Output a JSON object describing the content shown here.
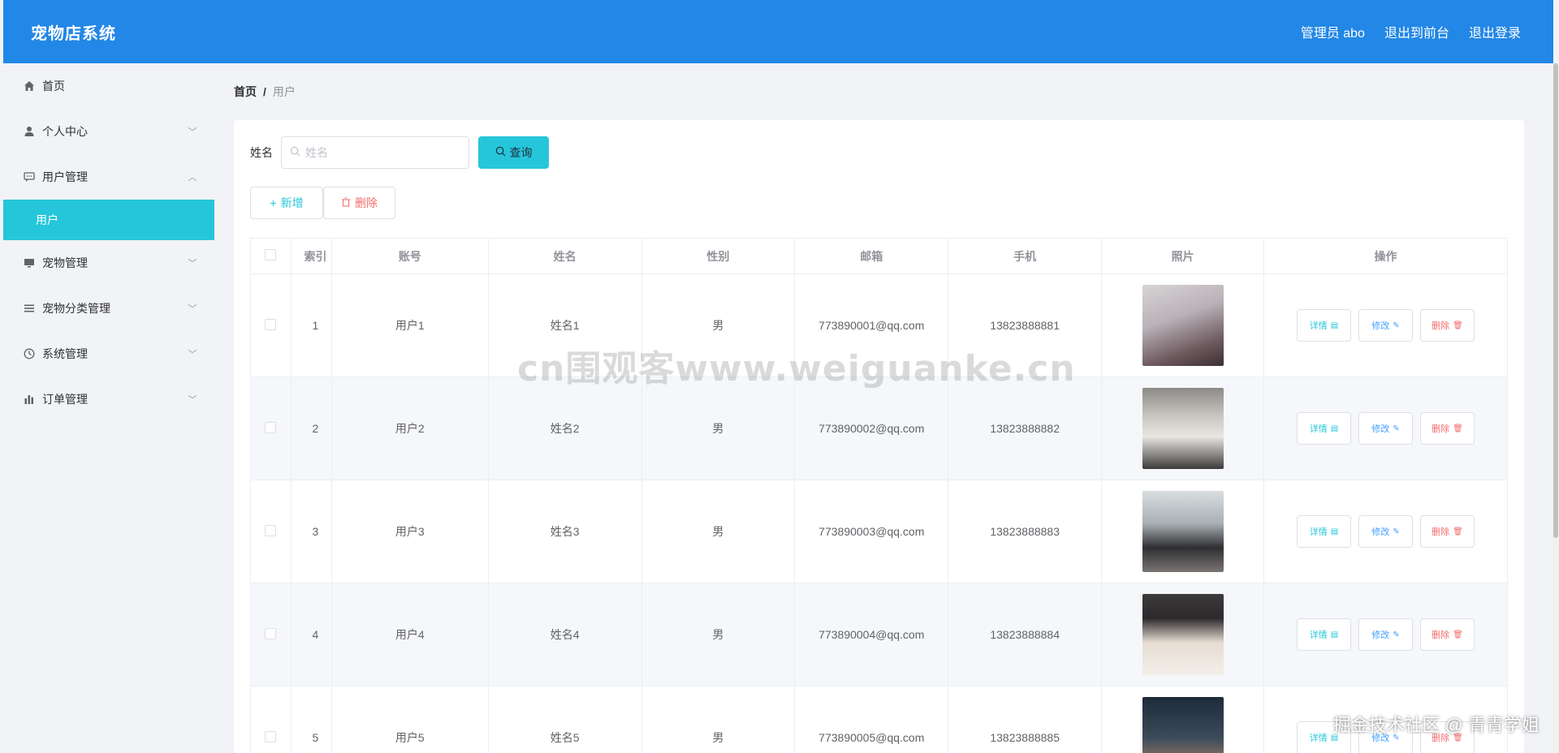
{
  "header": {
    "brand": "宠物店系统",
    "admin_label": "管理员 abo",
    "back_to_front": "退出到前台",
    "logout": "退出登录"
  },
  "sidebar": {
    "items": [
      {
        "label": "首页",
        "icon": "home-icon"
      },
      {
        "label": "个人中心",
        "icon": "user-icon"
      },
      {
        "label": "用户管理",
        "icon": "chat-icon"
      },
      {
        "label": "宠物管理",
        "icon": "monitor-icon"
      },
      {
        "label": "宠物分类管理",
        "icon": "list-icon"
      },
      {
        "label": "系统管理",
        "icon": "clock-icon"
      },
      {
        "label": "订单管理",
        "icon": "bar-chart-icon"
      }
    ],
    "active_sub": "用户"
  },
  "breadcrumb": {
    "home": "首页",
    "sep": "/",
    "current": "用户"
  },
  "search": {
    "label": "姓名",
    "placeholder": "姓名",
    "query_button": "查询"
  },
  "actions": {
    "add": "新增",
    "delete": "删除"
  },
  "table": {
    "headers": [
      "索引",
      "账号",
      "姓名",
      "性别",
      "邮箱",
      "手机",
      "照片",
      "操作"
    ],
    "rows": [
      {
        "index": "1",
        "account": "用户1",
        "name": "姓名1",
        "gender": "男",
        "email": "773890001@qq.com",
        "phone": "13823888881"
      },
      {
        "index": "2",
        "account": "用户2",
        "name": "姓名2",
        "gender": "男",
        "email": "773890002@qq.com",
        "phone": "13823888882"
      },
      {
        "index": "3",
        "account": "用户3",
        "name": "姓名3",
        "gender": "男",
        "email": "773890003@qq.com",
        "phone": "13823888883"
      },
      {
        "index": "4",
        "account": "用户4",
        "name": "姓名4",
        "gender": "男",
        "email": "773890004@qq.com",
        "phone": "13823888884"
      },
      {
        "index": "5",
        "account": "用户5",
        "name": "姓名5",
        "gender": "男",
        "email": "773890005@qq.com",
        "phone": "13823888885"
      }
    ],
    "op_labels": {
      "detail": "详情",
      "edit": "修改",
      "delete": "删除"
    }
  },
  "overlay": {
    "watermark": "cn围观客www.weiguanke.cn",
    "credit": "掘金技术社区 @ 青青学姐"
  },
  "colors": {
    "header_bg": "#2287e6",
    "accent": "#26c6da",
    "danger": "#f56c6c",
    "primary": "#409eff"
  }
}
